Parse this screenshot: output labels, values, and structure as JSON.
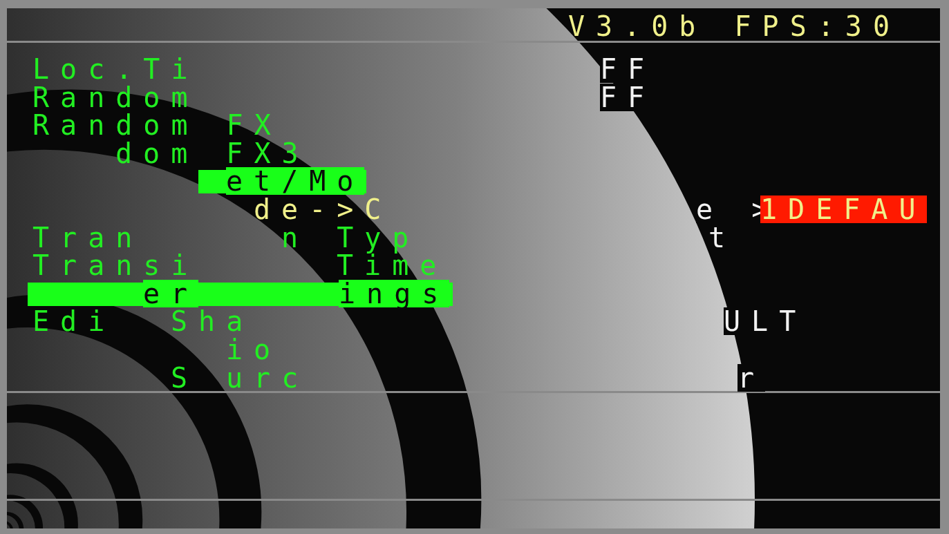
{
  "header": {
    "fragments": [
      {
        "text": "V3.0b FPS:30",
        "kind": "current"
      }
    ]
  },
  "rows": [
    {
      "highlighted": false,
      "fragments": [
        {
          "text": "Loc.Ti",
          "kind": "label"
        },
        {
          "text": "FF",
          "kind": "value"
        }
      ]
    },
    {
      "highlighted": false,
      "fragments": [
        {
          "text": "Random",
          "kind": "label"
        },
        {
          "text": "FF",
          "kind": "value"
        }
      ]
    },
    {
      "highlighted": false,
      "fragments": [
        {
          "text": "Random FX",
          "kind": "label"
        }
      ]
    },
    {
      "highlighted": false,
      "fragments": [
        {
          "text": "dom FX3",
          "kind": "label"
        }
      ]
    },
    {
      "highlighted": true,
      "fragments": [
        {
          "text": "et/Mo",
          "kind": "label"
        }
      ]
    },
    {
      "highlighted": false,
      "fragments": [
        {
          "text": "de->C",
          "kind": "current"
        },
        {
          "text": "e >",
          "kind": "value"
        },
        {
          "text": "1DEFAU",
          "kind": "choice"
        }
      ]
    },
    {
      "highlighted": false,
      "fragments": [
        {
          "text": "Tran",
          "kind": "label"
        },
        {
          "text": "n Typ",
          "kind": "label"
        },
        {
          "text": "t",
          "kind": "value"
        }
      ]
    },
    {
      "highlighted": false,
      "fragments": [
        {
          "text": "Transi",
          "kind": "label"
        },
        {
          "text": "Time",
          "kind": "label"
        }
      ]
    },
    {
      "highlighted": true,
      "fragments": [
        {
          "text": "er",
          "kind": "label"
        },
        {
          "text": "ings",
          "kind": "label"
        }
      ]
    },
    {
      "highlighted": false,
      "fragments": [
        {
          "text": "Edi",
          "kind": "label"
        },
        {
          "text": "Sha",
          "kind": "label"
        },
        {
          "text": "ULT",
          "kind": "value"
        }
      ]
    },
    {
      "highlighted": false,
      "fragments": [
        {
          "text": "io",
          "kind": "label"
        }
      ]
    },
    {
      "highlighted": false,
      "fragments": [
        {
          "text": "S",
          "kind": "label"
        },
        {
          "text": "urc",
          "kind": "label"
        },
        {
          "text": "r",
          "kind": "value"
        }
      ]
    }
  ]
}
